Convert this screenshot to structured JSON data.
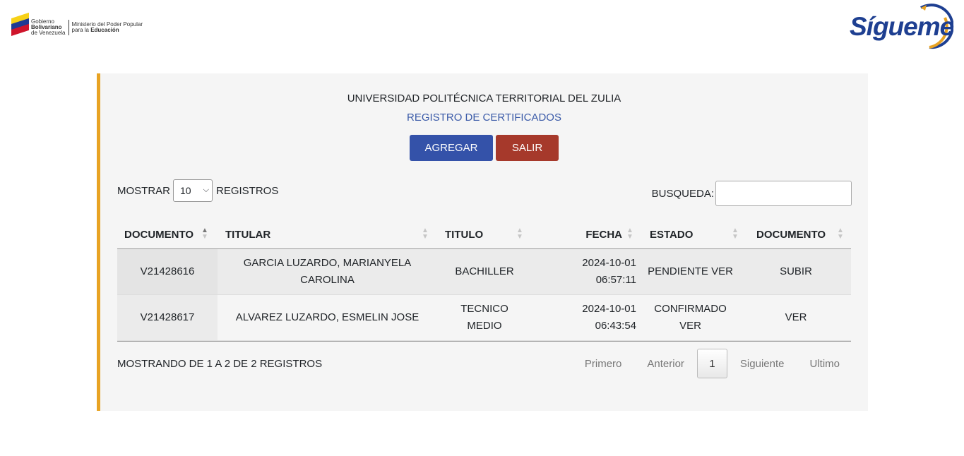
{
  "header": {
    "gov_line1": "Gobierno",
    "gov_line2": "Bolivariano",
    "gov_line3": "de Venezuela",
    "ministry_line1": "Ministerio del Poder Popular",
    "ministry_line2_prefix": "para la ",
    "ministry_line2_bold": "Educación",
    "brand": "Sígueme",
    "brand_color": "#1e3f91",
    "brand_accent": "#e8a323"
  },
  "card": {
    "title": "UNIVERSIDAD POLITÉCNICA TERRITORIAL DEL ZULIA",
    "subtitle": "REGISTRO DE CERTIFICADOS",
    "add_label": "AGREGAR",
    "exit_label": "SALIR",
    "accent_color": "#e8a323"
  },
  "controls": {
    "show_label": "MOSTRAR",
    "page_size": "10",
    "records_label": "REGISTROS",
    "search_label": "BUSQUEDA:",
    "search_value": ""
  },
  "table": {
    "columns": [
      "DOCUMENTO",
      "TITULAR",
      "TITULO",
      "FECHA",
      "ESTADO",
      "DOCUMENTO"
    ],
    "sorted_column": "DOCUMENTO",
    "rows": [
      {
        "documento": "V21428616",
        "titular": "GARCIA LUZARDO, MARIANYELA CAROLINA",
        "titulo": "BACHILLER",
        "fecha_date": "2024-10-01",
        "fecha_time": "06:57:11",
        "estado": "PENDIENTE VER",
        "accion": "SUBIR"
      },
      {
        "documento": "V21428617",
        "titular": "ALVAREZ LUZARDO, ESMELIN JOSE",
        "titulo": "TECNICO MEDIO",
        "fecha_date": "2024-10-01",
        "fecha_time": "06:43:54",
        "estado": "CONFIRMADO VER",
        "accion": "VER"
      }
    ]
  },
  "footer": {
    "info": "MOSTRANDO DE 1 A 2 DE 2 REGISTROS",
    "first": "Primero",
    "prev": "Anterior",
    "current": "1",
    "next": "Siguiente",
    "last": "Ultimo"
  }
}
